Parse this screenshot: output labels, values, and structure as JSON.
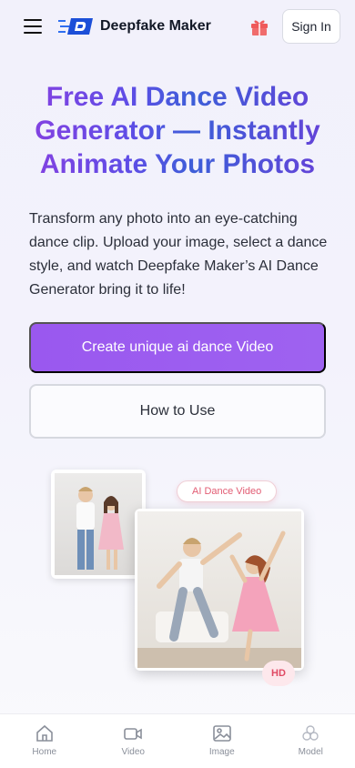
{
  "header": {
    "brand": "Deepfake Maker",
    "signin_label": "Sign In"
  },
  "hero": {
    "title": "Free AI Dance Video Generator — Instantly Animate Your Photos",
    "description": "Transform any photo into an eye-catching dance clip. Upload your image, select a dance style, and watch Deepfake Maker’s AI Dance Generator bring it to life!",
    "primary_cta": "Create unique ai dance Video",
    "secondary_cta": "How to Use"
  },
  "illustration": {
    "tag_label": "AI Dance Video",
    "hd_label": "HD"
  },
  "tabbar": {
    "items": [
      {
        "label": "Home",
        "icon": "home-icon"
      },
      {
        "label": "Video",
        "icon": "video-icon"
      },
      {
        "label": "Image",
        "icon": "image-icon"
      },
      {
        "label": "Model",
        "icon": "model-icon"
      }
    ]
  },
  "colors": {
    "accent": "#9b5cf0",
    "title_gradient_start": "#8a3fe0",
    "title_gradient_mid": "#3d5ed8",
    "badge": "#e25c73"
  }
}
